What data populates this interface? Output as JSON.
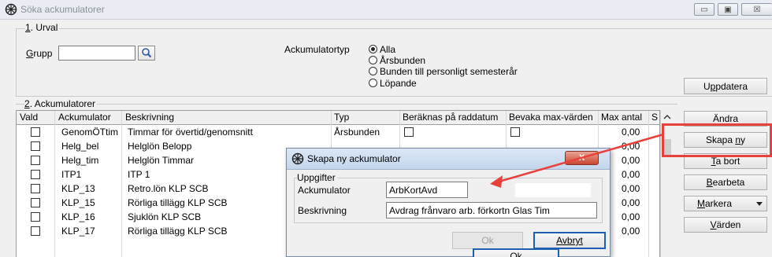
{
  "window": {
    "title": "Söka ackumulatorer",
    "buttons": [
      "▭",
      "▣",
      "☒"
    ]
  },
  "urval": {
    "label_prefix": "1",
    "label_rest": ". Urval",
    "grupp_label_ul": "G",
    "grupp_label_rest": "rupp",
    "grupp_value": "",
    "type_label": "Ackumulatortyp",
    "options": [
      "Alla",
      "Årsbunden",
      "Bunden till personligt semesterår",
      "Löpande"
    ],
    "selected": "Alla",
    "update_ul": "p",
    "update_pre": "U",
    "update_post": "pdatera"
  },
  "ackumulatorer": {
    "label_prefix": "2",
    "label_rest": ". Ackumulatorer",
    "columns": [
      "Vald",
      "Ackumulator",
      "Beskrivning",
      "Typ",
      "Beräknas på raddatum",
      "Bevaka max-värden",
      "Max antal",
      "S"
    ],
    "rows": [
      {
        "code": "GenomÖTtim",
        "desc": "Timmar för övertid/genomsnitt",
        "type": "Årsbunden",
        "max": "0,00"
      },
      {
        "code": "Helg_bel",
        "desc": "Helglön Belopp",
        "type": "",
        "max": "0,00"
      },
      {
        "code": "Helg_tim",
        "desc": "Helglön Timmar",
        "type": "",
        "max": "0,00"
      },
      {
        "code": "ITP1",
        "desc": "ITP 1",
        "type": "",
        "max": "0,00"
      },
      {
        "code": "KLP_13",
        "desc": "Retro.lön KLP SCB",
        "type": "",
        "max": "0,00"
      },
      {
        "code": "KLP_15",
        "desc": "Rörliga tillägg KLP SCB",
        "type": "",
        "max": "0,00"
      },
      {
        "code": "KLP_16",
        "desc": "Sjuklön KLP SCB",
        "type": "",
        "max": "0,00"
      },
      {
        "code": "KLP_17",
        "desc": "Rörliga tillägg KLP SCB",
        "type": "",
        "max": "0,00"
      }
    ]
  },
  "side": {
    "andra": "Ändra",
    "skapa_pre": "Skapa ",
    "skapa_ul": "n",
    "skapa_post": "y",
    "tabort_ul": "T",
    "tabort_post": "a bort",
    "bearbeta_ul": "B",
    "bearbeta_post": "earbeta",
    "markera_ul": "M",
    "markera_post": "arkera",
    "varden_ul": "V",
    "varden_post": "ärden"
  },
  "dialog": {
    "title": "Skapa ny ackumulator",
    "close": "X",
    "group": "Uppgifter",
    "ack_label": "Ackumulator",
    "ack_value": "ArbKortAvd",
    "desc_label": "Beskrivning",
    "desc_value": "Avdrag frånvaro arb. förkortn Glas Tim",
    "ok": "Ok",
    "ok_hint": "Ok",
    "cancel_ul": "A",
    "cancel_post": "vbryt"
  },
  "colors": {
    "highlight": "#e8403a",
    "focus": "#1e5fb4"
  }
}
